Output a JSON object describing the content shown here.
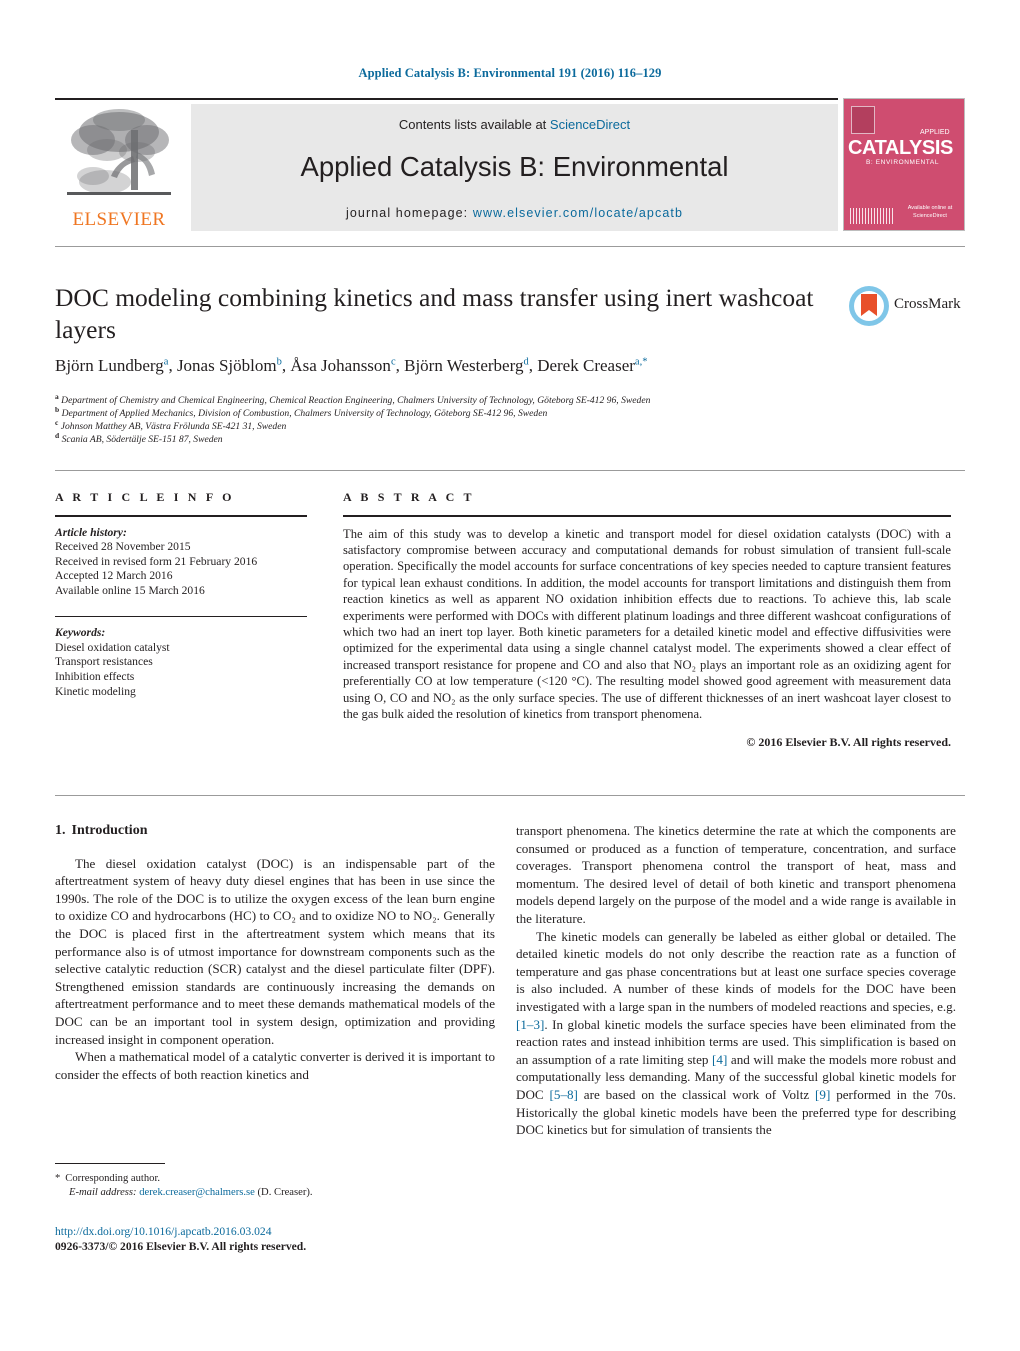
{
  "running_head": "Applied Catalysis B: Environmental 191 (2016) 116–129",
  "masthead": {
    "elsevier_label": "ELSEVIER",
    "contents_prefix": "Contents lists available at ",
    "sciencedirect": "ScienceDirect",
    "journal_title": "Applied Catalysis B: Environmental",
    "homepage_prefix": "journal homepage: ",
    "homepage_url": "www.elsevier.com/locate/apcatb",
    "cover": {
      "main_word": "CATALYSIS",
      "sup_word": "APPLIED",
      "sub_word": "B: ENVIRONMENTAL",
      "foot": "Available online at ScienceDirect"
    }
  },
  "article": {
    "title": "DOC modeling combining kinetics and mass transfer using inert washcoat layers",
    "crossmark_label": "CrossMark",
    "authors": [
      {
        "name": "Björn Lundberg",
        "marks": "a"
      },
      {
        "name": "Jonas Sjöblom",
        "marks": "b"
      },
      {
        "name": "Åsa Johansson",
        "marks": "c"
      },
      {
        "name": "Björn Westerberg",
        "marks": "d"
      },
      {
        "name": "Derek Creaser",
        "marks": "a,*"
      }
    ],
    "affiliations": [
      {
        "mark": "a",
        "text": "Department of Chemistry and Chemical Engineering, Chemical Reaction Engineering, Chalmers University of Technology, Göteborg SE-412 96, Sweden"
      },
      {
        "mark": "b",
        "text": "Department of Applied Mechanics, Division of Combustion, Chalmers University of Technology, Göteborg SE-412 96, Sweden"
      },
      {
        "mark": "c",
        "text": "Johnson Matthey AB, Västra Frölunda SE-421 31, Sweden"
      },
      {
        "mark": "d",
        "text": "Scania AB, Södertälje SE-151 87, Sweden"
      }
    ]
  },
  "article_info": {
    "label": "A R T I C L E   I N F O",
    "history_label": "Article history:",
    "history": [
      "Received 28 November 2015",
      "Received in revised form 21 February 2016",
      "Accepted 12 March 2016",
      "Available online 15 March 2016"
    ],
    "keywords_label": "Keywords:",
    "keywords": [
      "Diesel oxidation catalyst",
      "Transport resistances",
      "Inhibition effects",
      "Kinetic modeling"
    ]
  },
  "abstract": {
    "label": "A B S T R A C T",
    "text": "The aim of this study was to develop a kinetic and transport model for diesel oxidation catalysts (DOC) with a satisfactory compromise between accuracy and computational demands for robust simulation of transient full-scale operation. Specifically the model accounts for surface concentrations of key species needed to capture transient features for typical lean exhaust conditions. In addition, the model accounts for transport limitations and distinguish them from reaction kinetics as well as apparent NO oxidation inhibition effects due to reactions. To achieve this, lab scale experiments were performed with DOCs with different platinum loadings and three different washcoat configurations of which two had an inert top layer. Both kinetic parameters for a detailed kinetic model and effective diffusivities were optimized for the experimental data using a single channel catalyst model. The experiments showed a clear effect of increased transport resistance for propene and CO and also that NO₂ plays an important role as an oxidizing agent for preferentially CO at low temperature (<120 °C). The resulting model showed good agreement with measurement data using O, CO and NO₂ as the only surface species. The use of different thicknesses of an inert washcoat layer closest to the gas bulk aided the resolution of kinetics from transport phenomena.",
    "copyright": "© 2016 Elsevier B.V. All rights reserved."
  },
  "body": {
    "section_number": "1.",
    "section_title": "Introduction",
    "left_paragraphs": [
      "The diesel oxidation catalyst (DOC) is an indispensable part of the aftertreatment system of heavy duty diesel engines that has been in use since the 1990s. The role of the DOC is to utilize the oxygen excess of the lean burn engine to oxidize CO and hydrocarbons (HC) to CO₂ and to oxidize NO to NO₂. Generally the DOC is placed first in the aftertreatment system which means that its performance also is of utmost importance for downstream components such as the selective catalytic reduction (SCR) catalyst and the diesel particulate filter (DPF). Strengthened emission standards are continuously increasing the demands on aftertreatment performance and to meet these demands mathematical models of the DOC can be an important tool in system design, optimization and providing increased insight in component operation.",
      "When a mathematical model of a catalytic converter is derived it is important to consider the effects of both reaction kinetics and"
    ],
    "right_paragraph_1": "transport phenomena. The kinetics determine the rate at which the components are consumed or produced as a function of temperature, concentration, and surface coverages. Transport phenomena control the transport of heat, mass and momentum. The desired level of detail of both kinetic and transport phenomena models depend largely on the purpose of the model and a wide range is available in the literature.",
    "right_paragraph_2_parts": [
      "The kinetic models can generally be labeled as either global or detailed. The detailed kinetic models do not only describe the reaction rate as a function of temperature and gas phase concentrations but at least one surface species coverage is also included. A number of these kinds of models for the DOC have been investigated with a large span in the numbers of modeled reactions and species, e.g. ",
      "[1–3]",
      ". In global kinetic models the surface species have been eliminated from the reaction rates and instead inhibition terms are used. This simplification is based on an assumption of a rate limiting step ",
      "[4]",
      " and will make the models more robust and computationally less demanding. Many of the successful global kinetic models for DOC ",
      "[5–8]",
      " are based on the classical work of Voltz ",
      "[9]",
      " performed in the 70s. Historically the global kinetic models have been the preferred type for describing DOC kinetics but for simulation of transients the"
    ]
  },
  "footer": {
    "star": "*",
    "corresponding": "Corresponding author.",
    "email_label": "E-mail address:",
    "email": "derek.creaser@chalmers.se",
    "email_suffix": "(D. Creaser).",
    "doi": "http://dx.doi.org/10.1016/j.apcatb.2016.03.024",
    "issn": "0926-3373/© 2016 Elsevier B.V. All rights reserved."
  }
}
